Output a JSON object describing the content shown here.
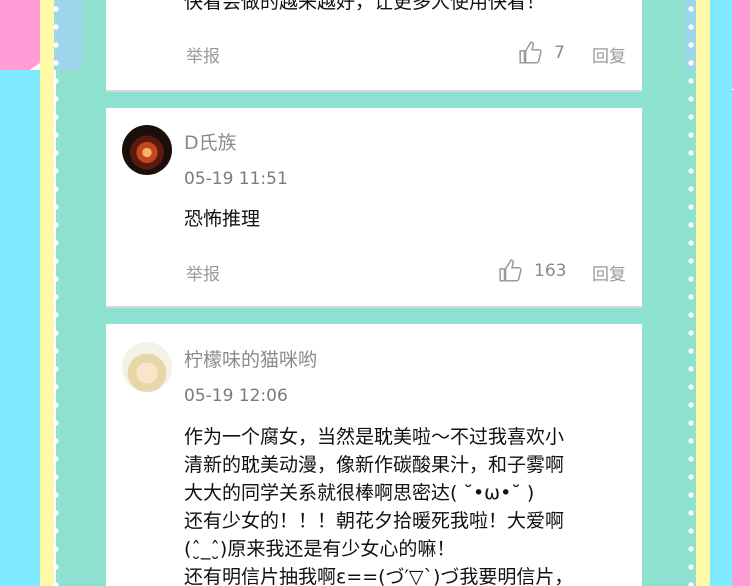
{
  "colors": {
    "frame_teal": "#8ee0cf",
    "frame_pink": "#ff9ed6",
    "frame_cyan": "#7fe9ff",
    "frame_yellow": "#fffaa8",
    "card_bg": "#ffffff",
    "meta_gray": "#8a8a8a"
  },
  "comments": [
    {
      "body_lines": [
        "快看会做的越来越好，让更多人使用快看！"
      ],
      "report_label": "举报",
      "like_icon": "thumbs-up-icon",
      "like_count": "7",
      "reply_label": "回复"
    },
    {
      "avatar_icon": "user-avatar-icon",
      "username": "D氏族",
      "timestamp": "05-19 11:51",
      "body_lines": [
        "恐怖推理"
      ],
      "report_label": "举报",
      "like_icon": "thumbs-up-icon",
      "like_count": "163",
      "reply_label": "回复"
    },
    {
      "avatar_icon": "user-avatar-icon",
      "username": "柠檬味的猫咪哟",
      "timestamp": "05-19 12:06",
      "body_lines": [
        "作为一个腐女，当然是耽美啦～不过我喜欢小",
        "清新的耽美动漫，像新作碳酸果汁，和子雾啊",
        "大大的同学关系就很棒啊思密达( ˘•ω•˘ )",
        "还有少女的！！！朝花夕拾暖死我啦！大爱啊",
        "(ˆ̮_ˆ̮)原来我还是有少女心的嘛！",
        "还有明信片抽我啊ε==(づ′▽`)づ我要明信片，"
      ]
    }
  ]
}
